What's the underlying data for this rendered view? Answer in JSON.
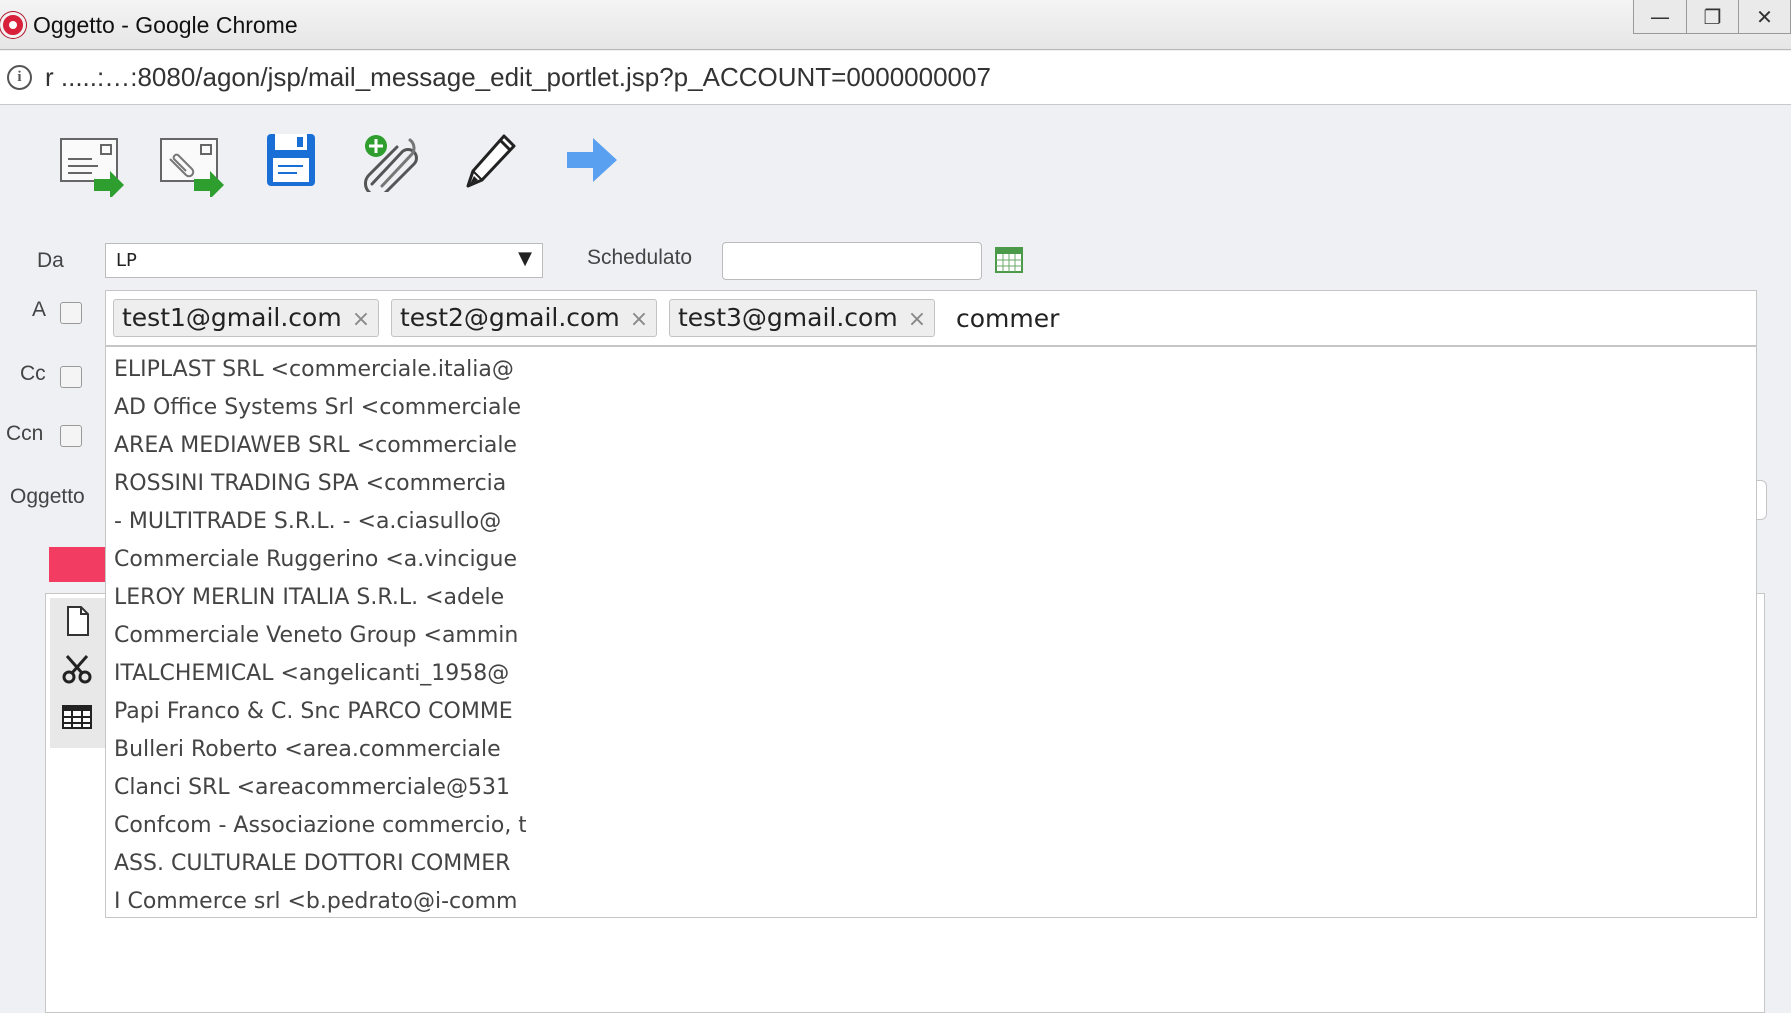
{
  "window": {
    "title": "Oggetto - Google Chrome",
    "minimize_glyph": "—",
    "restore_glyph": "❐",
    "close_glyph": "✕"
  },
  "address": {
    "url": "r  .....:…:8080/agon/jsp/mail_message_edit_portlet.jsp?p_ACCOUNT=0000000007",
    "info_glyph": "i"
  },
  "toolbar": {
    "icons": [
      "send-message-icon",
      "send-with-attachment-icon",
      "save-icon",
      "add-attachment-icon",
      "edit-pen-icon",
      "forward-arrow-icon"
    ]
  },
  "form": {
    "da_label": "Da",
    "da_value": "LP",
    "da_arrow": "▼",
    "schedulato_label": "Schedulato",
    "schedulato_value": "",
    "a_label": "A",
    "cc_label": "Cc",
    "ccn_label": "Ccn",
    "oggetto_label": "Oggetto"
  },
  "recipients": {
    "chips": [
      "test1@gmail.com",
      "test2@gmail.com",
      "test3@gmail.com"
    ],
    "remove_glyph": "×",
    "typed_text": "commer"
  },
  "suggestions": [
    "ELIPLAST SRL <commerciale.italia@",
    "AD Office Systems Srl <commerciale",
    "AREA MEDIAWEB SRL <commerciale",
    "ROSSINI TRADING SPA <commercia",
    "- MULTITRADE S.R.L. - <a.ciasullo@",
    "Commerciale Ruggerino <a.vincigue",
    "LEROY MERLIN ITALIA S.R.L. <adele",
    "Commerciale Veneto Group <ammin",
    "ITALCHEMICAL <angelicanti_1958@",
    "Papi Franco & C. Snc PARCO COMME",
    "Bulleri Roberto <area.commerciale",
    "Clanci SRL <areacommerciale@531",
    "Confcom - Associazione commercio, t",
    "ASS. CULTURALE DOTTORI COMMER",
    "I Commerce srl <b.pedrato@i-comm"
  ],
  "colors": {
    "accent_pink": "#f23c62",
    "save_blue": "#1a6fd6",
    "arrow_blue": "#5aa0f0",
    "send_green": "#2e9e2e"
  }
}
